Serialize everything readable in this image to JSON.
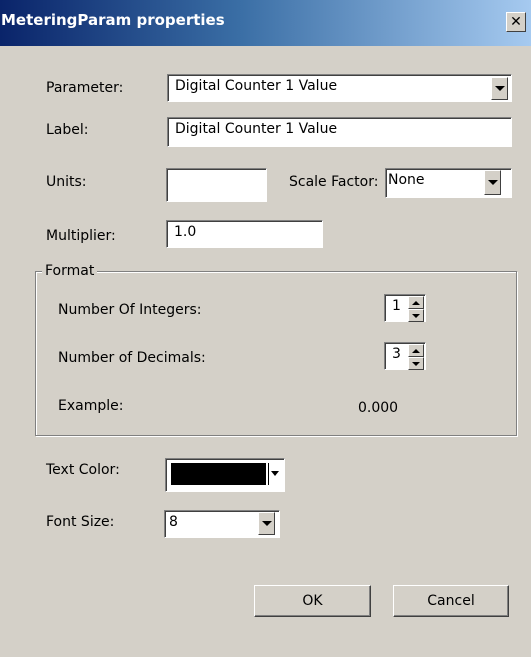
{
  "window": {
    "title": "MeteringParam properties",
    "close_glyph": "✕"
  },
  "parameter": {
    "label": "Parameter:",
    "value": "Digital Counter 1 Value"
  },
  "label_field": {
    "label": "Label:",
    "value": "Digital Counter 1 Value"
  },
  "units": {
    "label": "Units:",
    "value": ""
  },
  "scale_factor": {
    "label": "Scale Factor:",
    "value": "None"
  },
  "multiplier": {
    "label": "Multiplier:",
    "value": "1.0"
  },
  "format": {
    "legend": "Format",
    "integers_label": "Number Of Integers:",
    "integers_value": "1",
    "decimals_label": "Number of Decimals:",
    "decimals_value": "3",
    "example_label": "Example:",
    "example_value": "0.000"
  },
  "text_color": {
    "label": "Text Color:",
    "color": "#000000"
  },
  "font_size": {
    "label": "Font Size:",
    "value": "8"
  },
  "buttons": {
    "ok": "OK",
    "cancel": "Cancel"
  }
}
